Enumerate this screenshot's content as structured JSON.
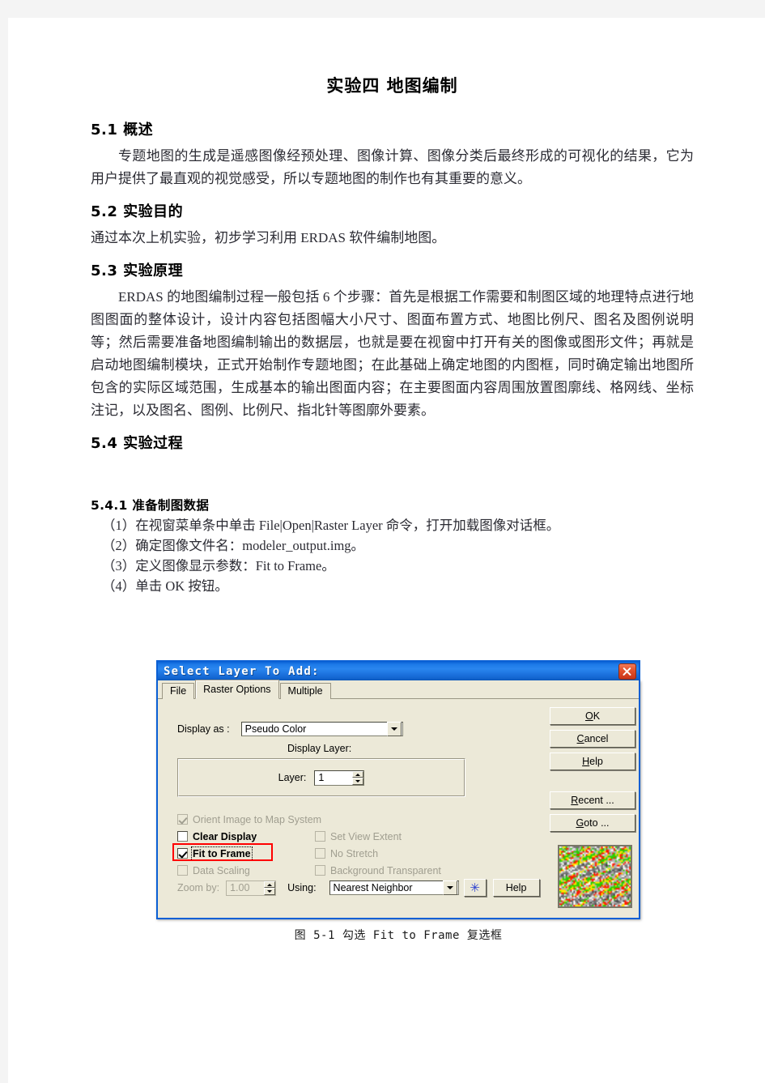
{
  "document": {
    "title": "实验四  地图编制",
    "sections": [
      {
        "heading": "5.1  概述",
        "paragraphs": [
          "专题地图的生成是遥感图像经预处理、图像计算、图像分类后最终形成的可视化的结果，它为用户提供了最直观的视觉感受，所以专题地图的制作也有其重要的意义。"
        ]
      },
      {
        "heading": "5.2  实验目的",
        "paragraphs": [
          "通过本次上机实验，初步学习利用 ERDAS 软件编制地图。"
        ]
      },
      {
        "heading": "5.3  实验原理",
        "paragraphs": [
          "ERDAS 的地图编制过程一般包括 6 个步骤：首先是根据工作需要和制图区域的地理特点进行地图图面的整体设计，设计内容包括图幅大小尺寸、图面布置方式、地图比例尺、图名及图例说明等；然后需要准备地图编制输出的数据层，也就是要在视窗中打开有关的图像或图形文件；再就是启动地图编制模块，正式开始制作专题地图；在此基础上确定地图的内图框，同时确定输出地图所包含的实际区域范围，生成基本的输出图面内容；在主要图面内容周围放置图廓线、格网线、坐标注记，以及图名、图例、比例尺、指北针等图廓外要素。"
        ]
      },
      {
        "heading": "5.4  实验过程"
      }
    ],
    "subsection": {
      "heading": "5.4.1  准备制图数据",
      "steps": [
        "（1）在视窗菜单条中单击 File|Open|Raster Layer 命令，打开加载图像对话框。",
        "（2）确定图像文件名：modeler_output.img。",
        "（3）定义图像显示参数：Fit to Frame。",
        "（4）单击 OK 按钮。"
      ]
    },
    "figure_caption": "图 5-1 勾选 Fit to Frame 复选框"
  },
  "dialog": {
    "title": "Select Layer To Add:",
    "close_label": "×",
    "tabs": [
      {
        "label": "File",
        "active": false
      },
      {
        "label": "Raster Options",
        "active": true
      },
      {
        "label": "Multiple",
        "active": false
      }
    ],
    "display_as": {
      "label": "Display as :",
      "value": "Pseudo Color"
    },
    "display_layer": {
      "group_label": "Display Layer:",
      "layer_label": "Layer:",
      "layer_value": "1"
    },
    "checkboxes": [
      {
        "label": "Orient Image to Map System",
        "checked": true,
        "enabled": false
      },
      {
        "label": "Clear Display",
        "checked": false,
        "enabled": true
      },
      {
        "label": "Set View Extent",
        "checked": false,
        "enabled": false
      },
      {
        "label": "Fit to Frame",
        "checked": true,
        "enabled": true,
        "highlighted": true
      },
      {
        "label": "No Stretch",
        "checked": false,
        "enabled": false
      },
      {
        "label": "Data Scaling",
        "checked": false,
        "enabled": false
      },
      {
        "label": "Background Transparent",
        "checked": false,
        "enabled": false
      }
    ],
    "zoom_row": {
      "zoom_label": "Zoom by:",
      "zoom_value": "1.00",
      "using_label": "Using:",
      "using_value": "Nearest Neighbor",
      "asterisk_label": "✳",
      "help_label": "Help"
    },
    "side_buttons": [
      {
        "mnemonic": "O",
        "rest": "K"
      },
      {
        "mnemonic": "C",
        "rest": "ancel"
      },
      {
        "mnemonic": "H",
        "rest": "elp"
      }
    ],
    "side_buttons_lower": [
      {
        "mnemonic": "R",
        "rest": "ecent ..."
      },
      {
        "mnemonic": "G",
        "rest": "oto ..."
      }
    ],
    "colors": {
      "titlebar_blue": "#1d7ae8",
      "dialog_face": "#ece9d8",
      "highlight_red": "#ff0000",
      "accent_blue": "#2a3fd0"
    },
    "thumbnail": {
      "name": "classified-raster-preview",
      "palette": [
        "#ff1a00",
        "#28d000",
        "#ffe400",
        "#b4b4b4",
        "#ffffff",
        "#707070",
        "#3f3f3f"
      ]
    }
  }
}
